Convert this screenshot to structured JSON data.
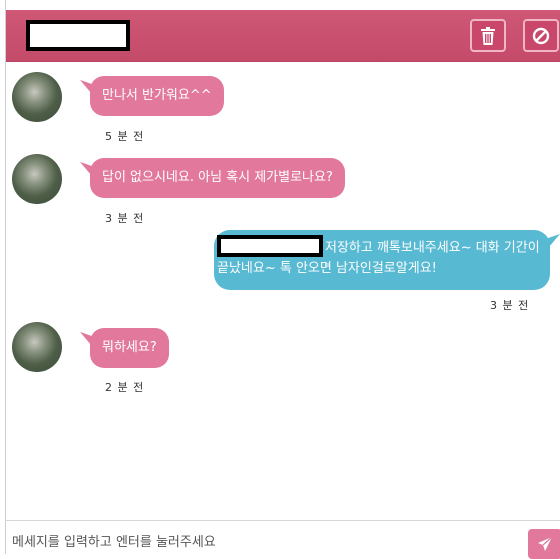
{
  "header": {
    "delete_icon": "trash-icon",
    "block_icon": "block-icon"
  },
  "messages": [
    {
      "side": "left",
      "text": "만나서 반가워요^^",
      "time": "5 분 전"
    },
    {
      "side": "left",
      "text": "답이 없으시네요. 아님 혹시 제가별로나요?",
      "time": "3 분 전"
    },
    {
      "side": "right",
      "text": "저장하고 깨톡보내주세요~ 대화 기간이끝났네요~ 톡 안오면 남자인걸로알게요!",
      "time": "3 분 전"
    },
    {
      "side": "left",
      "text": "뭐하세요?",
      "time": "2 분 전"
    }
  ],
  "composer": {
    "placeholder": "메세지를 입력하고 엔터를 눌러주세요",
    "send_icon": "paper-plane-icon"
  },
  "colors": {
    "header": "#c84d6d",
    "incoming_bubble": "#e2799c",
    "outgoing_bubble": "#58b9d3"
  }
}
